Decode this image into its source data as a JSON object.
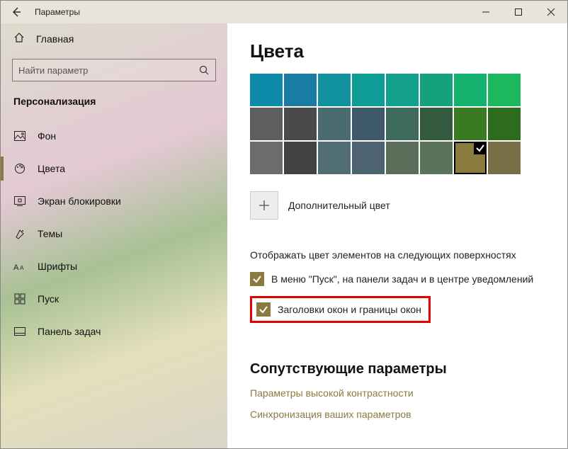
{
  "titlebar": {
    "title": "Параметры"
  },
  "sidebar": {
    "home_label": "Главная",
    "search_placeholder": "Найти параметр",
    "section_title": "Персонализация",
    "items": [
      {
        "id": "background",
        "label": "Фон"
      },
      {
        "id": "colors",
        "label": "Цвета",
        "active": true
      },
      {
        "id": "lockscreen",
        "label": "Экран блокировки"
      },
      {
        "id": "themes",
        "label": "Темы"
      },
      {
        "id": "fonts",
        "label": "Шрифты"
      },
      {
        "id": "start",
        "label": "Пуск"
      },
      {
        "id": "taskbar",
        "label": "Панель задач"
      }
    ]
  },
  "content": {
    "page_title": "Цвета",
    "swatches": [
      [
        "#0d8aa8",
        "#1a7ca3",
        "#12919e",
        "#0e9c96",
        "#13a08c",
        "#13a07b",
        "#14b26f",
        "#1db85e"
      ],
      [
        "#5e5e5e",
        "#4a4a4a",
        "#4a6b72",
        "#3f5a6b",
        "#3f6b5a",
        "#335a3f",
        "#3a7a22",
        "#2e6b1f"
      ],
      [
        "#6c6c6c",
        "#424242",
        "#506e74",
        "#4d6470",
        "#5a6e5a",
        "#597459",
        "#8a7a3d",
        "#7a6e47"
      ]
    ],
    "selected": {
      "row": 2,
      "col": 6
    },
    "custom_color_label": "Дополнительный цвет",
    "surface_label": "Отображать цвет элементов на следующих поверхностях",
    "checkboxes": [
      {
        "label": "В меню \"Пуск\", на панели задач и в центре уведомлений",
        "checked": true,
        "highlight": false
      },
      {
        "label": "Заголовки окон и границы окон",
        "checked": true,
        "highlight": true
      }
    ],
    "related_title": "Сопутствующие параметры",
    "links": [
      "Параметры высокой контрастности",
      "Синхронизация ваших параметров"
    ]
  }
}
